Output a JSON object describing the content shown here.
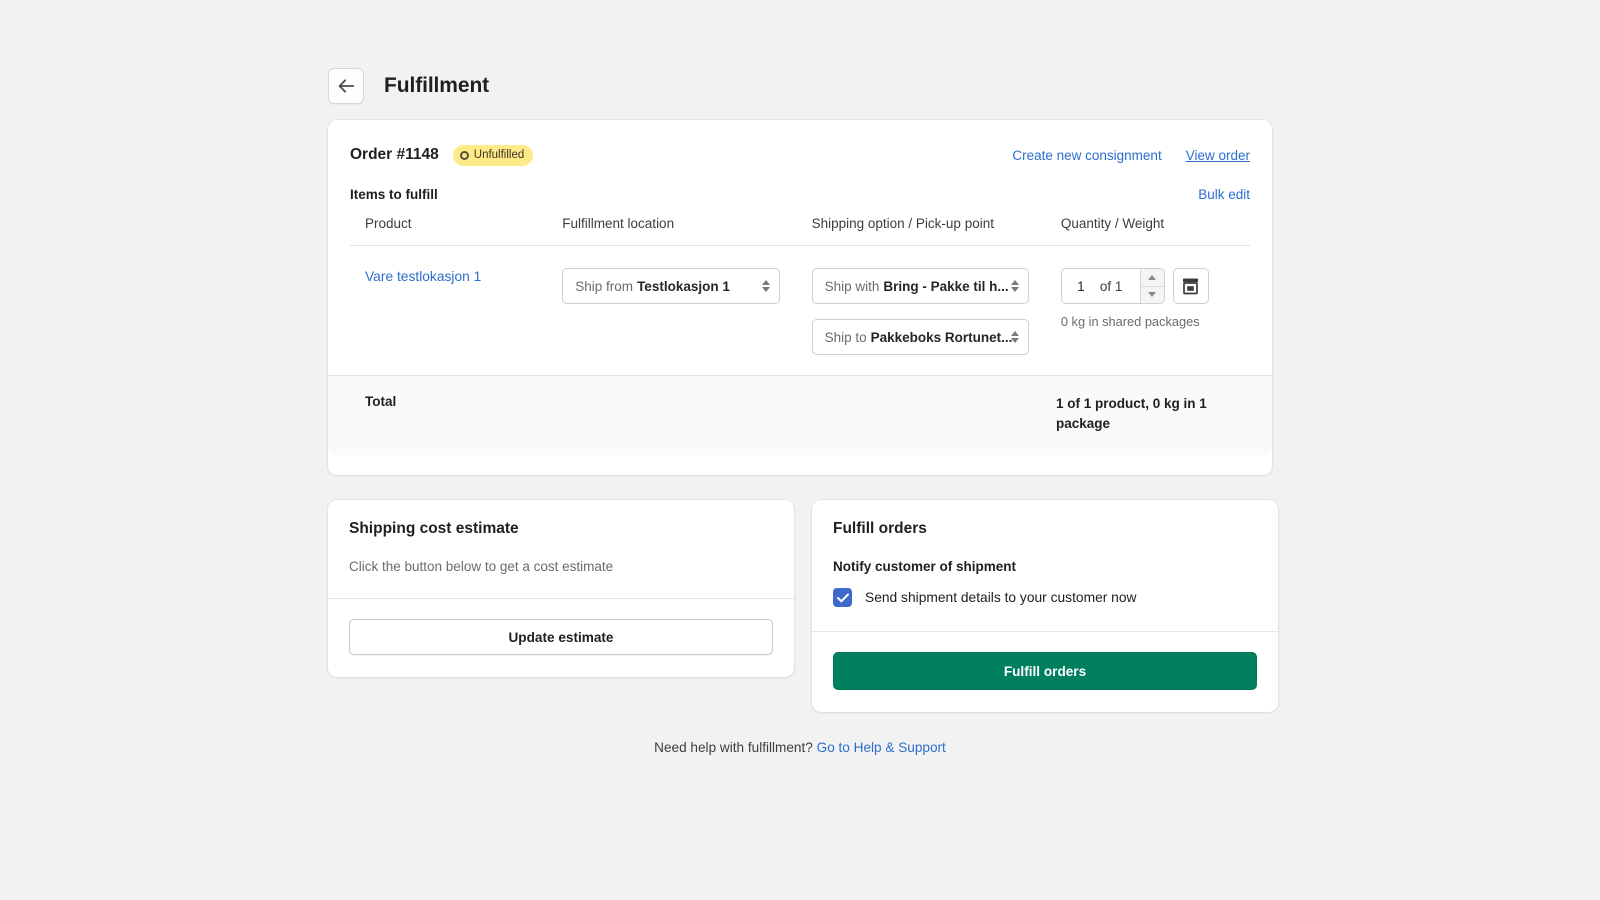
{
  "header": {
    "back_icon": "arrow-left-icon",
    "title": "Fulfillment"
  },
  "order_card": {
    "order_id": "Order #1148",
    "status_badge": {
      "label": "Unfulfilled",
      "icon": "circle-outline-icon",
      "bg_color": "#FFEA8A",
      "text_color": "#3D3320"
    },
    "links": {
      "create_consignment": "Create new consignment",
      "view_order": "View order"
    },
    "items_title": "Items to fulfill",
    "bulk_edit": "Bulk edit",
    "table": {
      "columns": [
        "Product",
        "Fulfillment location",
        "Shipping option / Pick-up point",
        "Quantity / Weight"
      ],
      "rows": [
        {
          "product": "Vare testlokasjon 1",
          "location_select": {
            "prefix": "Ship from",
            "value": "Testlokasjon 1"
          },
          "shipping_select": {
            "prefix": "Ship with",
            "value": "Bring - Pakke til h..."
          },
          "pickup_select": {
            "prefix": "Ship to",
            "value": "Pakkeboks Rortunet..."
          },
          "quantity": "1",
          "quantity_of": "of 1",
          "package_icon": "package-box-icon",
          "weight_note": "0 kg in shared packages"
        }
      ]
    },
    "total": {
      "label": "Total",
      "value": "1 of 1 product, 0 kg in 1 package"
    }
  },
  "cost_card": {
    "title": "Shipping cost estimate",
    "description": "Click the button below to get a cost estimate",
    "button_label": "Update estimate"
  },
  "fulfill_card": {
    "title": "Fulfill orders",
    "notify_label": "Notify customer of shipment",
    "checkbox": {
      "label": "Send shipment details to your customer now",
      "checked": true,
      "color": "#3F68CD"
    },
    "button_label": "Fulfill orders",
    "button_color": "#007F5F"
  },
  "footer": {
    "text": "Need help with fulfillment?",
    "link": "Go to Help & Support"
  }
}
